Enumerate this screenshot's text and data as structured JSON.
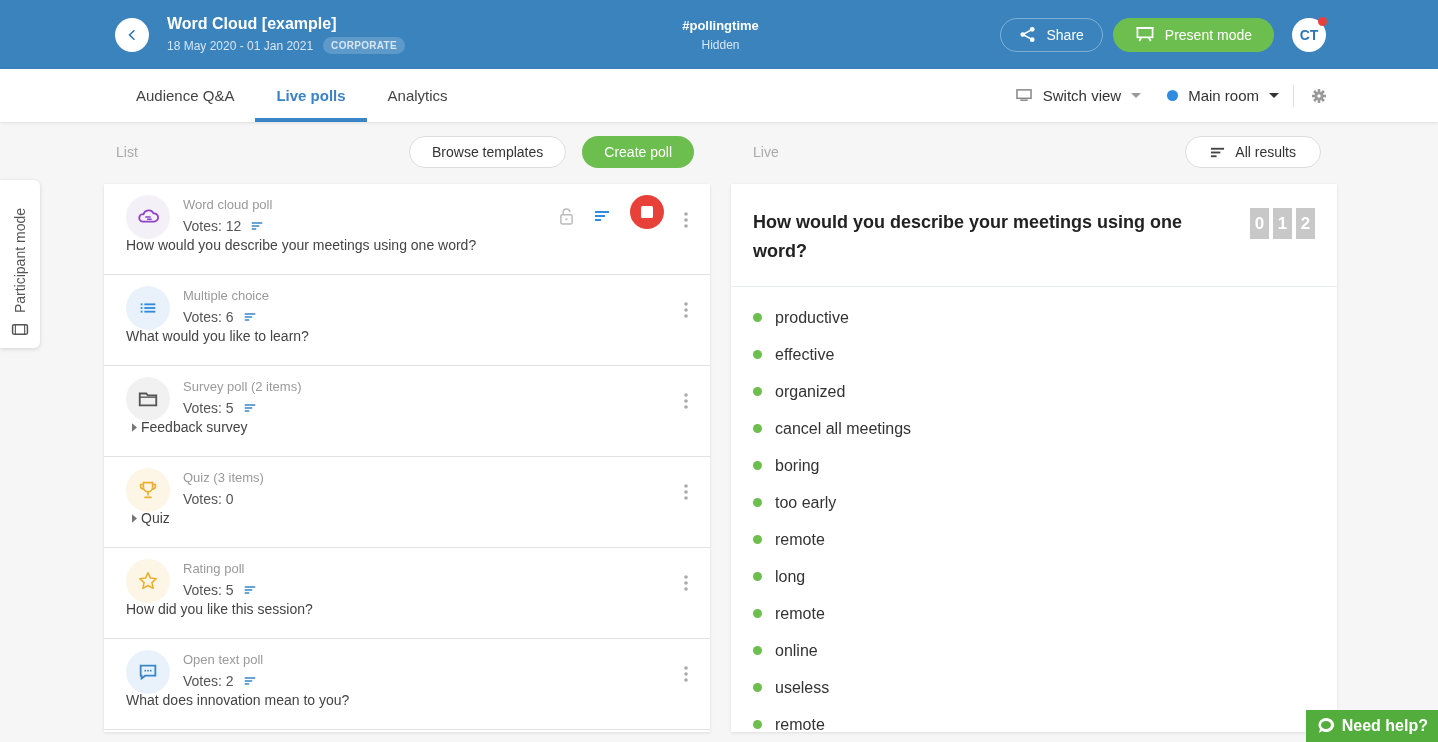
{
  "header": {
    "title": "Word Cloud [example]",
    "dates": "18 May 2020 - 01 Jan 2021",
    "badge": "CORPORATE",
    "event_code": "#pollingtime",
    "visibility": "Hidden",
    "share": "Share",
    "present": "Present mode",
    "avatar": "CT",
    "notification": true
  },
  "tabs": [
    {
      "label": "Audience Q&A",
      "selected": false
    },
    {
      "label": "Live polls",
      "selected": true
    },
    {
      "label": "Analytics",
      "selected": false
    }
  ],
  "view_controls": {
    "switch_view": "Switch view",
    "room": "Main room"
  },
  "side_tab": {
    "label": "Participant mode"
  },
  "list_toolbar": {
    "label": "List",
    "browse": "Browse templates",
    "create": "Create poll"
  },
  "live_toolbar": {
    "label": "Live",
    "all_results": "All results"
  },
  "polls": [
    {
      "kind": "word_cloud",
      "type": "Word cloud poll",
      "votes": "Votes: 12",
      "results_icon": true,
      "live": true,
      "expandable": false,
      "detail": "How would you describe your meetings using one word?"
    },
    {
      "kind": "multiple_choice",
      "type": "Multiple choice",
      "votes": "Votes: 6",
      "results_icon": true,
      "live": false,
      "expandable": false,
      "detail": "What would you like to learn?"
    },
    {
      "kind": "survey",
      "type": "Survey poll (2 items)",
      "votes": "Votes: 5",
      "results_icon": true,
      "live": false,
      "expandable": true,
      "detail": "Feedback survey"
    },
    {
      "kind": "quiz",
      "type": "Quiz (3 items)",
      "votes": "Votes: 0",
      "results_icon": false,
      "live": false,
      "expandable": true,
      "detail": "Quiz"
    },
    {
      "kind": "rating",
      "type": "Rating poll",
      "votes": "Votes: 5",
      "results_icon": true,
      "live": false,
      "expandable": false,
      "detail": "How did you like this session?"
    },
    {
      "kind": "open_text",
      "type": "Open text poll",
      "votes": "Votes: 2",
      "results_icon": true,
      "live": false,
      "expandable": false,
      "detail": "What does innovation mean to you?"
    }
  ],
  "live_poll": {
    "question": "How would you describe your meetings using one word?",
    "counter": [
      "0",
      "1",
      "2"
    ],
    "answers": [
      "productive",
      "effective",
      "organized",
      "cancel all meetings",
      "boring",
      "too early",
      "remote",
      "long",
      "remote",
      "online",
      "useless",
      "remote"
    ]
  },
  "help_button": "Need help?"
}
